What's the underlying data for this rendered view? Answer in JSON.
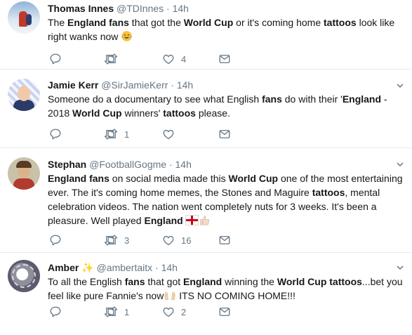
{
  "tweets": [
    {
      "name": "Thomas Innes",
      "handle": "@TDInnes",
      "time": "14h",
      "lines": [
        [
          {
            "t": "The "
          },
          {
            "t": "England fans",
            "b": true
          },
          {
            "t": " that got the "
          },
          {
            "t": "World Cup",
            "b": true
          },
          {
            "t": " or it's coming home "
          },
          {
            "t": "tattoos",
            "b": true
          },
          {
            "t": " look like"
          }
        ],
        [
          {
            "t": "right wanks now "
          }
        ]
      ],
      "emoji": "tears-of-joy-emoji",
      "replies": "",
      "retweets": "",
      "likes": "4"
    },
    {
      "name": "Jamie Kerr",
      "handle": "@SirJamieKerr",
      "time": "14h",
      "lines": [
        [
          {
            "t": "Someone do a documentary to see what English "
          },
          {
            "t": "fans",
            "b": true
          },
          {
            "t": " do with their '"
          },
          {
            "t": "England",
            "b": true
          },
          {
            "t": " -"
          }
        ],
        [
          {
            "t": "2018 "
          },
          {
            "t": "World Cup",
            "b": true
          },
          {
            "t": " winners' "
          },
          {
            "t": "tattoos",
            "b": true
          },
          {
            "t": " please."
          }
        ]
      ],
      "replies": "",
      "retweets": "1",
      "likes": ""
    },
    {
      "name": "Stephan",
      "handle": "@FootballGogme",
      "time": "14h",
      "lines": [
        [
          {
            "t": "England fans",
            "b": true
          },
          {
            "t": " on social media made this "
          },
          {
            "t": "World Cup",
            "b": true
          },
          {
            "t": " one of the most entertaining"
          }
        ],
        [
          {
            "t": "ever. The it's coming home memes, the Stones and Maguire "
          },
          {
            "t": "tattoos",
            "b": true
          },
          {
            "t": ", mental"
          }
        ],
        [
          {
            "t": "celebration videos. The nation went completely nuts for 3 weeks. It's been a"
          }
        ],
        [
          {
            "t": "pleasure. Well played "
          },
          {
            "t": "England",
            "b": true
          }
        ]
      ],
      "emoji": "england-flag thumbs-up-emoji",
      "replies": "",
      "retweets": "3",
      "likes": "16"
    },
    {
      "name": "Amber",
      "handle": "@ambertaitx",
      "time": "14h",
      "lines": [
        [
          {
            "t": "To all the English "
          },
          {
            "t": "fans",
            "b": true
          },
          {
            "t": " that got "
          },
          {
            "t": "England",
            "b": true
          },
          {
            "t": " winning the "
          },
          {
            "t": "World Cup tattoos",
            "b": true
          },
          {
            "t": "...bet you"
          }
        ],
        [
          {
            "t": "feel like pure Fannie's now"
          },
          {
            "t": " ITS NO COMING HOME!!!",
            "pre": "raised-hands-emoji"
          }
        ]
      ],
      "replies": "",
      "retweets": "1",
      "likes": "2"
    }
  ],
  "colors": {
    "text": "#14171a",
    "muted": "#657786",
    "border": "#e6ecf0",
    "sparkle": "#f5b400",
    "flag_red": "#d0021b"
  },
  "icons": [
    "reply-icon",
    "retweet-icon",
    "like-icon",
    "direct-message-icon",
    "chevron-down-icon"
  ]
}
